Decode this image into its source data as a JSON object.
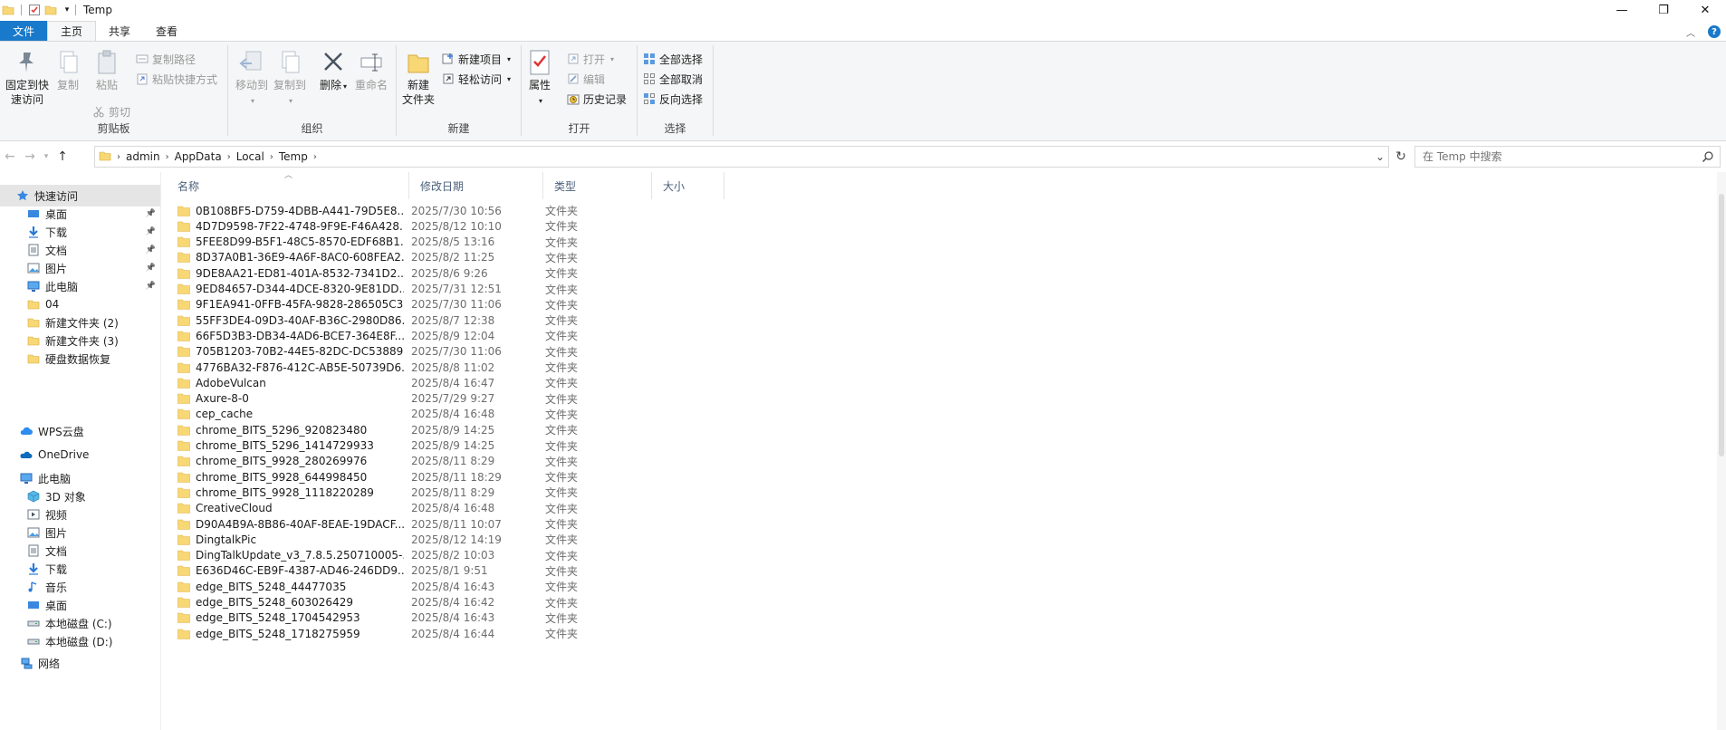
{
  "window": {
    "title": "Temp",
    "controls": {
      "minimize": "—",
      "maximize": "❐",
      "close": "✕"
    }
  },
  "ribbon": {
    "tabs": [
      {
        "label": "文件"
      },
      {
        "label": "主页"
      },
      {
        "label": "共享"
      },
      {
        "label": "查看"
      }
    ],
    "groups": {
      "clipboard": {
        "label": "剪贴板",
        "pin": "固定到快速访问",
        "pin_line1": "固定到快",
        "pin_line2": "速访问",
        "copy": "复制",
        "paste": "粘贴",
        "copy_path": "复制路径",
        "paste_shortcut": "粘贴快捷方式",
        "cut": "剪切"
      },
      "organize": {
        "label": "组织",
        "move_to": "移动到",
        "copy_to": "复制到",
        "delete": "删除",
        "rename": "重命名"
      },
      "new": {
        "label": "新建",
        "new_folder_line1": "新建",
        "new_folder_line2": "文件夹",
        "new_item": "新建项目",
        "easy_access": "轻松访问"
      },
      "open": {
        "label": "打开",
        "properties": "属性",
        "open": "打开",
        "edit": "编辑",
        "history": "历史记录"
      },
      "select": {
        "label": "选择",
        "select_all": "全部选择",
        "select_none": "全部取消",
        "invert": "反向选择"
      }
    }
  },
  "address": {
    "crumbs": [
      "admin",
      "AppData",
      "Local",
      "Temp"
    ],
    "search_placeholder": "在 Temp 中搜索"
  },
  "nav": {
    "quick_access": "快速访问",
    "quick_items": [
      {
        "label": "桌面",
        "icon": "desktop-icon",
        "pinned": true
      },
      {
        "label": "下载",
        "icon": "download-icon",
        "pinned": true
      },
      {
        "label": "文档",
        "icon": "document-icon",
        "pinned": true
      },
      {
        "label": "图片",
        "icon": "picture-icon",
        "pinned": true
      },
      {
        "label": "此电脑",
        "icon": "computer-icon",
        "pinned": true
      },
      {
        "label": "04",
        "icon": "folder-icon",
        "pinned": false
      },
      {
        "label": "新建文件夹 (2)",
        "icon": "folder-icon",
        "pinned": false
      },
      {
        "label": "新建文件夹 (3)",
        "icon": "folder-icon",
        "pinned": false
      },
      {
        "label": "硬盘数据恢复",
        "icon": "folder-icon",
        "pinned": false
      }
    ],
    "wps": "WPS云盘",
    "onedrive": "OneDrive",
    "this_pc": "此电脑",
    "pc_items": [
      {
        "label": "3D 对象",
        "icon": "3d-objects-icon"
      },
      {
        "label": "视频",
        "icon": "video-icon"
      },
      {
        "label": "图片",
        "icon": "picture-icon"
      },
      {
        "label": "文档",
        "icon": "document-icon"
      },
      {
        "label": "下载",
        "icon": "download-icon"
      },
      {
        "label": "音乐",
        "icon": "music-icon"
      },
      {
        "label": "桌面",
        "icon": "desktop-icon"
      },
      {
        "label": "本地磁盘 (C:)",
        "icon": "drive-icon"
      },
      {
        "label": "本地磁盘 (D:)",
        "icon": "drive-icon"
      }
    ],
    "network": "网络"
  },
  "columns": {
    "name": "名称",
    "date": "修改日期",
    "type": "类型",
    "size": "大小"
  },
  "files": [
    {
      "name": "0B108BF5-D759-4DBB-A441-79D5E8...",
      "date": "2025/7/30 10:56",
      "type": "文件夹"
    },
    {
      "name": "4D7D9598-7F22-4748-9F9E-F46A428...",
      "date": "2025/8/12 10:10",
      "type": "文件夹"
    },
    {
      "name": "5FEE8D99-B5F1-48C5-8570-EDF68B1...",
      "date": "2025/8/5 13:16",
      "type": "文件夹"
    },
    {
      "name": "8D37A0B1-36E9-4A6F-8AC0-608FEA2...",
      "date": "2025/8/2 11:25",
      "type": "文件夹"
    },
    {
      "name": "9DE8AA21-ED81-401A-8532-7341D2...",
      "date": "2025/8/6 9:26",
      "type": "文件夹"
    },
    {
      "name": "9ED84657-D344-4DCE-8320-9E81DD...",
      "date": "2025/7/31 12:51",
      "type": "文件夹"
    },
    {
      "name": "9F1EA941-0FFB-45FA-9828-286505C3...",
      "date": "2025/7/30 11:06",
      "type": "文件夹"
    },
    {
      "name": "55FF3DE4-09D3-40AF-B36C-2980D86...",
      "date": "2025/8/7 12:38",
      "type": "文件夹"
    },
    {
      "name": "66F5D3B3-DB34-4AD6-BCE7-364E8F...",
      "date": "2025/8/9 12:04",
      "type": "文件夹"
    },
    {
      "name": "705B1203-70B2-44E5-82DC-DC53889...",
      "date": "2025/7/30 11:06",
      "type": "文件夹"
    },
    {
      "name": "4776BA32-F876-412C-AB5E-50739D6...",
      "date": "2025/8/8 11:02",
      "type": "文件夹"
    },
    {
      "name": "AdobeVulcan",
      "date": "2025/8/4 16:47",
      "type": "文件夹"
    },
    {
      "name": "Axure-8-0",
      "date": "2025/7/29 9:27",
      "type": "文件夹"
    },
    {
      "name": "cep_cache",
      "date": "2025/8/4 16:48",
      "type": "文件夹"
    },
    {
      "name": "chrome_BITS_5296_920823480",
      "date": "2025/8/9 14:25",
      "type": "文件夹"
    },
    {
      "name": "chrome_BITS_5296_1414729933",
      "date": "2025/8/9 14:25",
      "type": "文件夹"
    },
    {
      "name": "chrome_BITS_9928_280269976",
      "date": "2025/8/11 8:29",
      "type": "文件夹"
    },
    {
      "name": "chrome_BITS_9928_644998450",
      "date": "2025/8/11 18:29",
      "type": "文件夹"
    },
    {
      "name": "chrome_BITS_9928_1118220289",
      "date": "2025/8/11 8:29",
      "type": "文件夹"
    },
    {
      "name": "CreativeCloud",
      "date": "2025/8/4 16:48",
      "type": "文件夹"
    },
    {
      "name": "D90A4B9A-8B86-40AF-8EAE-19DACF...",
      "date": "2025/8/11 10:07",
      "type": "文件夹"
    },
    {
      "name": "DingtalkPic",
      "date": "2025/8/12 14:19",
      "type": "文件夹"
    },
    {
      "name": "DingTalkUpdate_v3_7.8.5.250710005-...",
      "date": "2025/8/2 10:03",
      "type": "文件夹"
    },
    {
      "name": "E636D46C-EB9F-4387-AD46-246DD9...",
      "date": "2025/8/1 9:51",
      "type": "文件夹"
    },
    {
      "name": "edge_BITS_5248_44477035",
      "date": "2025/8/4 16:43",
      "type": "文件夹"
    },
    {
      "name": "edge_BITS_5248_603026429",
      "date": "2025/8/4 16:42",
      "type": "文件夹"
    },
    {
      "name": "edge_BITS_5248_1704542953",
      "date": "2025/8/4 16:43",
      "type": "文件夹"
    },
    {
      "name": "edge_BITS_5248_1718275959",
      "date": "2025/8/4 16:44",
      "type": "文件夹"
    }
  ],
  "colors": {
    "accent": "#1979ca",
    "folder": "#f8d775",
    "selected": "#e5e5e5"
  }
}
